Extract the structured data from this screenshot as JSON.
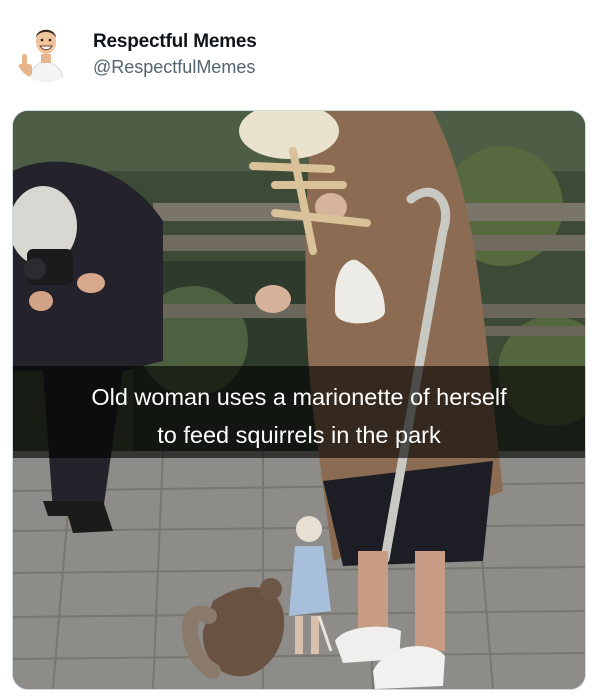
{
  "tweet": {
    "display_name": "Respectful Memes",
    "handle": "@RespectfulMemes",
    "avatar_icon": "thumbs-up-man-avatar"
  },
  "media": {
    "caption_line_1": "Old woman uses a marionette of herself",
    "caption_line_2": "to feed squirrels in the park",
    "colors": {
      "caption_band": "#000000",
      "caption_text": "#ffffff"
    }
  }
}
